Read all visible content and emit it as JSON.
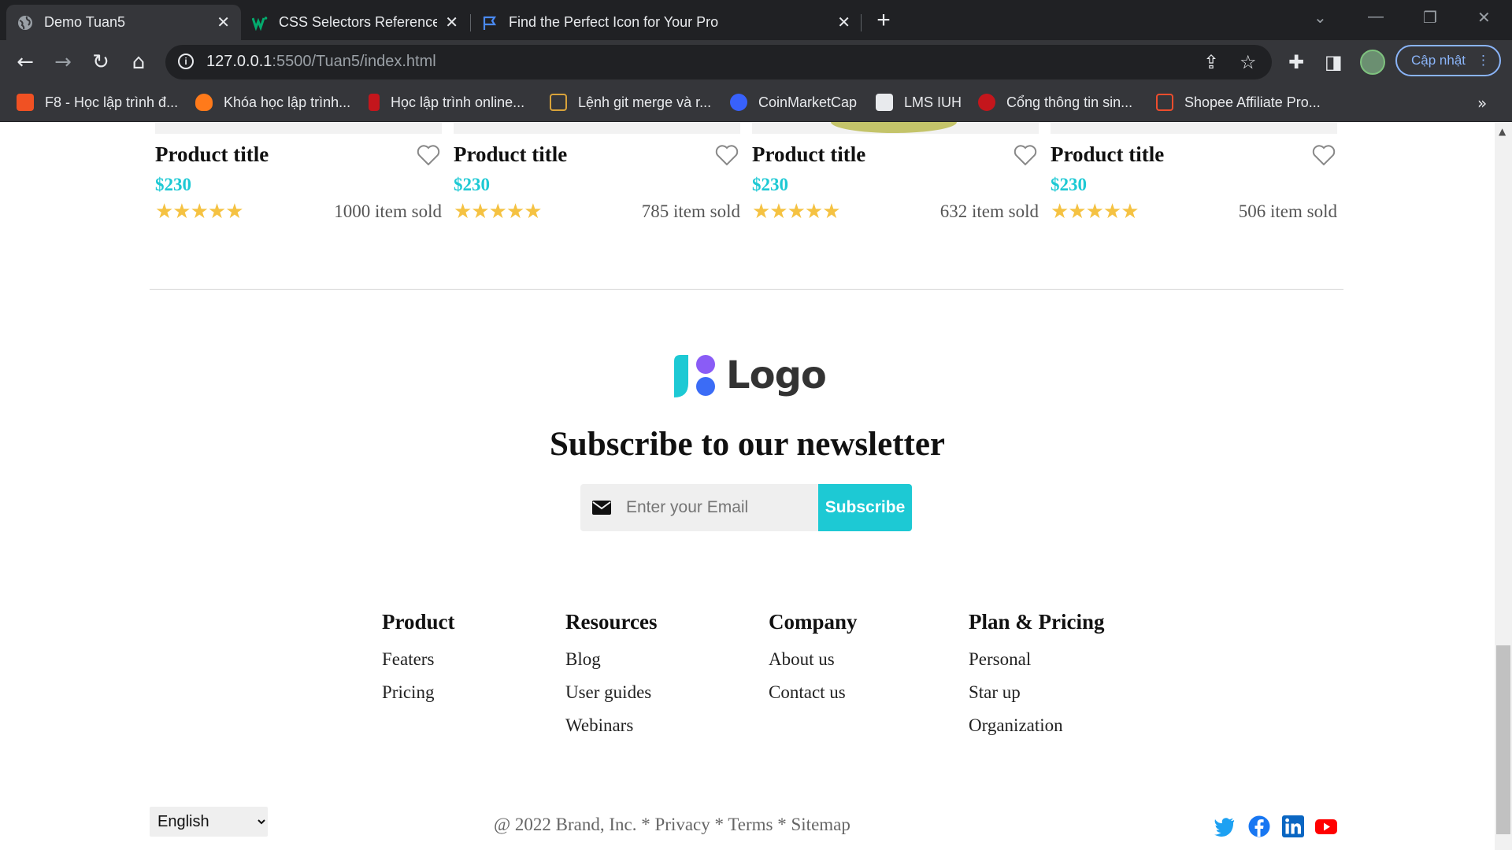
{
  "browser": {
    "tabs": [
      {
        "title": "Demo Tuan5",
        "active": true
      },
      {
        "title": "CSS Selectors Reference",
        "active": false
      },
      {
        "title": "Find the Perfect Icon for Your Pro",
        "active": false
      }
    ],
    "url_host": "127.0.0.1",
    "url_rest": ":5500/Tuan5/index.html",
    "update_label": "Cập nhật",
    "bookmarks": [
      {
        "label": "F8 - Học lập trình đ...",
        "icon": "f8-icon",
        "color": "#f05123"
      },
      {
        "label": "Khóa học lập trình...",
        "icon": "fire-icon",
        "color": "#ff7a1a"
      },
      {
        "label": "Học lập trình online...",
        "icon": "flag-icon",
        "color": "#c4161c"
      },
      {
        "label": "Lệnh git merge và r...",
        "icon": "git-icon",
        "color": "#d9a33a"
      },
      {
        "label": "CoinMarketCap",
        "icon": "coinmarketcap-icon",
        "color": "#3861fb"
      },
      {
        "label": "LMS IUH",
        "icon": "lms-icon",
        "color": "#e8eaed"
      },
      {
        "label": "Cổng thông tin sin...",
        "icon": "portal-icon",
        "color": "#c4161c"
      },
      {
        "label": "Shopee Affiliate Pro...",
        "icon": "shopee-icon",
        "color": "#ee4d2d"
      }
    ]
  },
  "products": [
    {
      "title": "Product title",
      "price": "$230",
      "stars": "★★★★★",
      "rating": 5,
      "sold": "1000 item sold"
    },
    {
      "title": "Product title",
      "price": "$230",
      "stars": "★★★★★",
      "rating": 5,
      "sold": "785 item sold"
    },
    {
      "title": "Product title",
      "price": "$230",
      "stars": "★★★★★",
      "rating": 5,
      "sold": "632 item sold"
    },
    {
      "title": "Product title",
      "price": "$230",
      "stars": "★★★★★",
      "rating": 5,
      "sold": "506 item sold"
    }
  ],
  "footer": {
    "logo_text": "Logo",
    "newsletter_title": "Subscribe to our newsletter",
    "email_placeholder": "Enter your Email",
    "subscribe_label": "Subscribe",
    "columns": [
      {
        "heading": "Product",
        "links": [
          "Featers",
          "Pricing"
        ]
      },
      {
        "heading": "Resources",
        "links": [
          "Blog",
          "User guides",
          "Webinars"
        ]
      },
      {
        "heading": "Company",
        "links": [
          "About us",
          "Contact us"
        ]
      },
      {
        "heading": "Plan & Pricing",
        "links": [
          "Personal",
          "Star up",
          "Organization"
        ]
      }
    ],
    "language": "English",
    "legal": "@ 2022 Brand, Inc. * Privacy * Terms * Sitemap",
    "social": [
      "twitter-icon",
      "facebook-icon",
      "linkedin-icon",
      "youtube-icon"
    ]
  },
  "colors": {
    "accent": "#1dc9d4",
    "star": "#f5c242",
    "chrome_dark": "#202124",
    "chrome": "#35363a"
  }
}
